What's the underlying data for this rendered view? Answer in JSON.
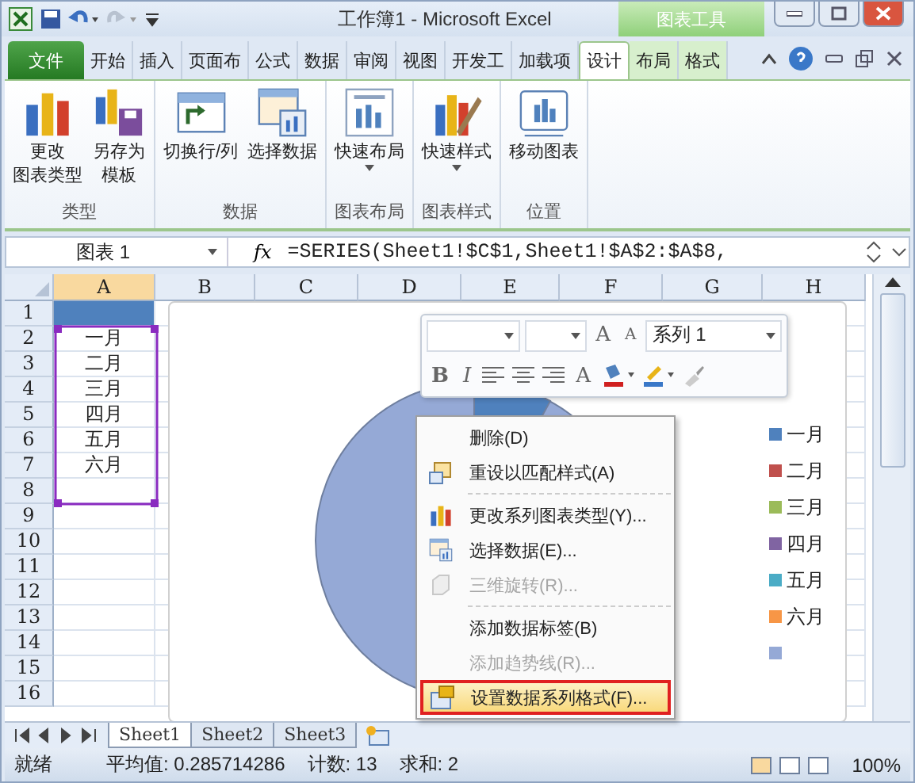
{
  "title_bar": {
    "title": "工作簿1 - Microsoft Excel",
    "context_group": "图表工具"
  },
  "tabs": [
    {
      "label": "文件",
      "kind": "file",
      "selected": false
    },
    {
      "label": "开始",
      "kind": "normal",
      "selected": false
    },
    {
      "label": "插入",
      "kind": "normal",
      "selected": false
    },
    {
      "label": "页面布",
      "kind": "normal",
      "selected": false
    },
    {
      "label": "公式",
      "kind": "normal",
      "selected": false
    },
    {
      "label": "数据",
      "kind": "normal",
      "selected": false
    },
    {
      "label": "审阅",
      "kind": "normal",
      "selected": false
    },
    {
      "label": "视图",
      "kind": "normal",
      "selected": false
    },
    {
      "label": "开发工",
      "kind": "normal",
      "selected": false
    },
    {
      "label": "加载项",
      "kind": "normal",
      "selected": false
    },
    {
      "label": "设计",
      "kind": "context",
      "selected": true
    },
    {
      "label": "布局",
      "kind": "context",
      "selected": false
    },
    {
      "label": "格式",
      "kind": "context",
      "selected": false
    }
  ],
  "ribbon_groups": [
    {
      "label": "类型",
      "buttons": [
        {
          "lines": [
            "更改",
            "图表类型"
          ]
        },
        {
          "lines": [
            "另存为",
            "模板"
          ]
        }
      ]
    },
    {
      "label": "数据",
      "buttons": [
        {
          "lines": [
            "切换行/列"
          ]
        },
        {
          "lines": [
            "选择数据"
          ]
        }
      ]
    },
    {
      "label": "图表布局",
      "buttons": [
        {
          "lines": [
            "快速布局"
          ],
          "dropdown": true
        }
      ]
    },
    {
      "label": "图表样式",
      "buttons": [
        {
          "lines": [
            "快速样式"
          ],
          "dropdown": true
        }
      ]
    },
    {
      "label": "位置",
      "buttons": [
        {
          "lines": [
            "移动图表"
          ]
        }
      ]
    }
  ],
  "name_box": "图表 1",
  "function_label": "fx",
  "formula": "=SERIES(Sheet1!$C$1,Sheet1!$A$2:$A$8,",
  "columns": [
    "A",
    "B",
    "C",
    "D",
    "E",
    "F",
    "G",
    "H"
  ],
  "rows": [
    {
      "header": "1",
      "selected": true
    },
    {
      "header": "2",
      "value": "一月",
      "selected": false
    },
    {
      "header": "3",
      "value": "二月",
      "selected": false
    },
    {
      "header": "4",
      "value": "三月",
      "selected": false
    },
    {
      "header": "5",
      "value": "四月",
      "selected": false
    },
    {
      "header": "6",
      "value": "五月",
      "selected": false
    },
    {
      "header": "7",
      "value": "六月",
      "selected": false
    },
    {
      "header": "8",
      "selected": false
    },
    {
      "header": "9",
      "selected": false
    },
    {
      "header": "10",
      "selected": false
    },
    {
      "header": "11",
      "selected": false
    },
    {
      "header": "12",
      "selected": false
    },
    {
      "header": "13",
      "selected": false
    },
    {
      "header": "14",
      "selected": false
    },
    {
      "header": "15",
      "selected": false
    },
    {
      "header": "16",
      "selected": false
    }
  ],
  "chart": {
    "legend": [
      {
        "label": "一月",
        "color": "#4f81bd"
      },
      {
        "label": "二月",
        "color": "#c0504d"
      },
      {
        "label": "三月",
        "color": "#9bbb59"
      },
      {
        "label": "四月",
        "color": "#8064a2"
      },
      {
        "label": "五月",
        "color": "#4bacc6"
      },
      {
        "label": "六月",
        "color": "#f79646"
      },
      {
        "color": "#95a9d6"
      }
    ]
  },
  "mini_toolbar": {
    "series_box": "系列 1",
    "grow": "A",
    "shrink": "A",
    "bold": "B",
    "italic": "I",
    "font_color": "A"
  },
  "context_menu": [
    {
      "kind": "item",
      "label": "删除(D)",
      "disabled": false,
      "highlighted": false
    },
    {
      "kind": "item",
      "label": "重设以匹配样式(A)",
      "disabled": false,
      "highlighted": false
    },
    {
      "kind": "separator"
    },
    {
      "kind": "item",
      "label": "更改系列图表类型(Y)...",
      "disabled": false,
      "highlighted": false
    },
    {
      "kind": "item",
      "label": "选择数据(E)...",
      "disabled": false,
      "highlighted": false
    },
    {
      "kind": "item",
      "label": "三维旋转(R)...",
      "disabled": true,
      "highlighted": false
    },
    {
      "kind": "separator"
    },
    {
      "kind": "item",
      "label": "添加数据标签(B)",
      "disabled": false,
      "highlighted": false
    },
    {
      "kind": "item",
      "label": "添加趋势线(R)...",
      "disabled": true,
      "highlighted": false
    },
    {
      "kind": "item",
      "label": "设置数据系列格式(F)...",
      "disabled": false,
      "highlighted": true
    }
  ],
  "sheet_tabs": [
    {
      "label": "Sheet1",
      "selected": true
    },
    {
      "label": "Sheet2",
      "selected": false
    },
    {
      "label": "Sheet3",
      "selected": false
    }
  ],
  "status_bar": {
    "state": "就绪",
    "average": "平均值: 0.285714286",
    "count": "计数: 13",
    "sum": "求和: 2",
    "zoom": "100%"
  }
}
